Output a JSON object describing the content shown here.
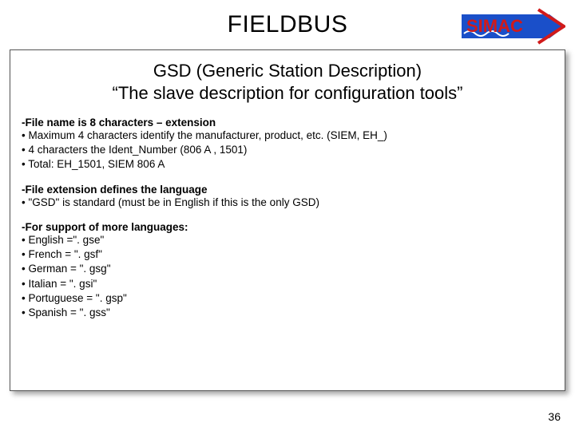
{
  "header": {
    "title": "FIELDBUS",
    "logo_text": "SIMAC"
  },
  "subtitle_line1": "GSD (Generic Station Description)",
  "subtitle_line2": "“The slave description for configuration tools”",
  "block1": {
    "head": "-File name is 8 characters – extension",
    "l1": "• Maximum 4 characters identify the manufacturer, product, etc. (SIEM, EH_)",
    "l2": "• 4 characters the Ident_Number (806 A , 1501)",
    "l3": "• Total: EH_1501, SIEM 806 A"
  },
  "block2": {
    "head": "-File extension defines the language",
    "l1": "• \"GSD\" is standard (must be in English if this is the only GSD)"
  },
  "block3": {
    "head": "-For support of more languages:",
    "l1": "• English =\". gse\"",
    "l2": "• French = \". gsf\"",
    "l3": "• German = \". gsg\"",
    "l4": "• Italian = \". gsi\"",
    "l5": "• Portuguese = \". gsp\"",
    "l6": "• Spanish = \". gss\""
  },
  "page_number": "36"
}
